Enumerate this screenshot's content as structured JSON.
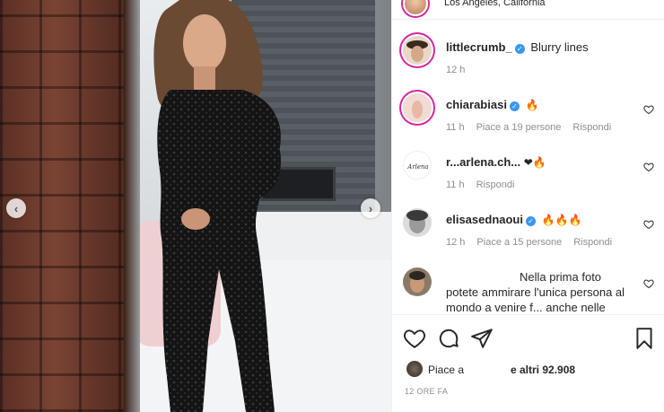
{
  "post": {
    "location": "Los Angeles, California",
    "image_alt": "Photo"
  },
  "caption": {
    "username": "littlecrumb_",
    "text": "Blurry lines",
    "time": "12 h"
  },
  "comments": [
    {
      "username": "chiarabiasi",
      "verified": true,
      "text": "🔥",
      "time": "11 h",
      "likes": "Piace a 19 persone",
      "reply": "Rispondi"
    },
    {
      "username": "r...arlena.ch...",
      "verified": false,
      "text": "❤🔥",
      "time": "11 h",
      "likes": "",
      "reply": "Rispondi"
    },
    {
      "username": "elisasednaoui",
      "verified": true,
      "text": "🔥🔥🔥",
      "time": "12 h",
      "likes": "Piace a 15 persone",
      "reply": "Rispondi"
    },
    {
      "username": "",
      "verified": false,
      "text_line1": "Nella prima foto",
      "text_line2": "potete ammirare l'unica persona al",
      "text_line3": "mondo a venire f... anche nelle"
    }
  ],
  "likes": {
    "prefix": "Piace a",
    "suffix": "e altri 92.908"
  },
  "timestamp": "12 ORE FA",
  "icons": {
    "like": "heart-icon",
    "comment": "comment-icon",
    "share": "share-icon",
    "save": "bookmark-icon",
    "prev": "chevron-left-icon",
    "next": "chevron-right-icon"
  },
  "colors": {
    "verified": "#3897f0",
    "story_ring": "#d6249f",
    "meta_text": "#8e8e8e",
    "text": "#262626"
  }
}
